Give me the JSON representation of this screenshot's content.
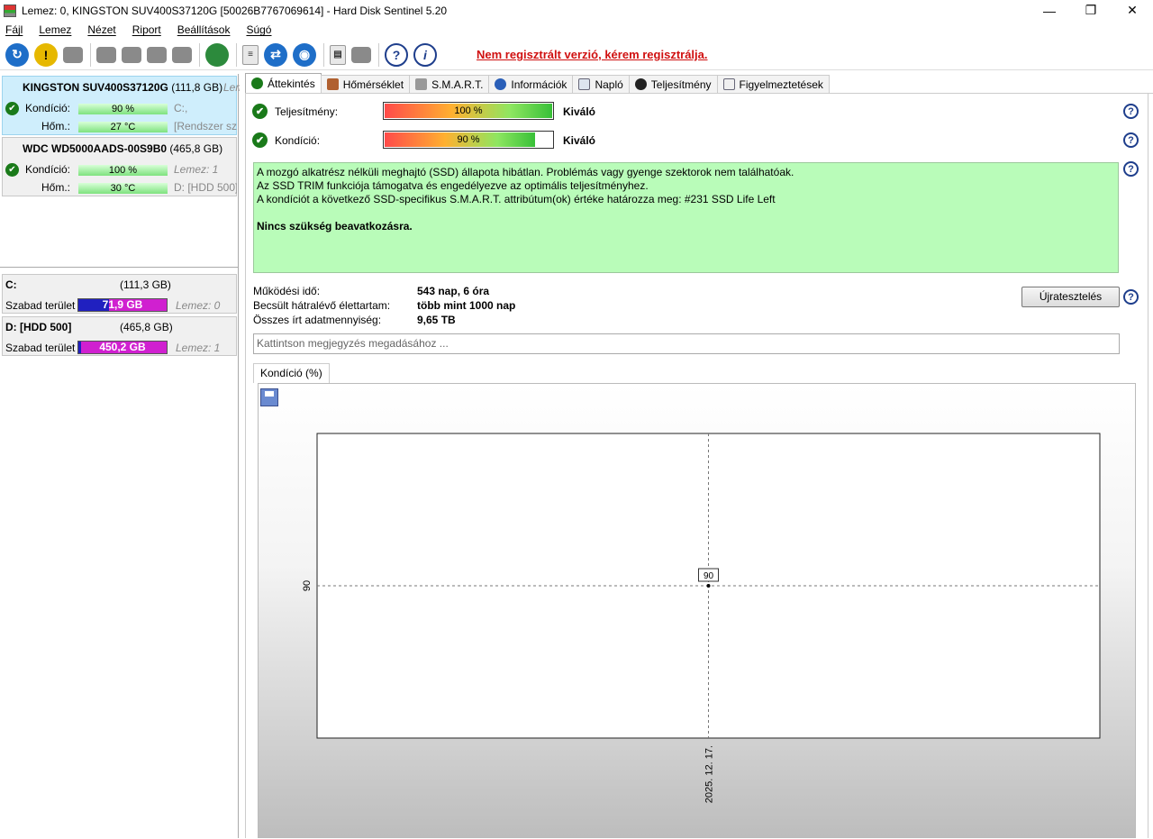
{
  "window": {
    "title": "Lemez: 0, KINGSTON SUV400S37120G [50026B7767069614]  -  Hard Disk Sentinel 5.20"
  },
  "menu": [
    "Fájl",
    "Lemez",
    "Nézet",
    "Riport",
    "Beállítások",
    "Súgó"
  ],
  "toolbar": {
    "register_note": "Nem regisztrált verzió, kérem regisztrálja."
  },
  "drives": [
    {
      "name": "KINGSTON SUV400S37120G",
      "size": "(111,8 GB)",
      "side_top": "Lem",
      "condition_label": "Kondíció:",
      "condition": "90 %",
      "condition_side": "C:,",
      "temp_label": "Hőm.:",
      "temp": "27 °C",
      "temp_side": "[Rendszer szá"
    },
    {
      "name": "WDC WD5000AADS-00S9B0",
      "size": "(465,8 GB)",
      "side_top": "",
      "condition_label": "Kondíció:",
      "condition": "100 %",
      "condition_side": "Lemez: 1",
      "temp_label": "Hőm.:",
      "temp": "30 °C",
      "temp_side": "D: [HDD 500]"
    }
  ],
  "volumes": [
    {
      "name": "C:",
      "size": "(111,3 GB)",
      "free_label": "Szabad terület",
      "free": "71,9 GB",
      "disk": "Lemez: 0",
      "used_fraction": 0.35
    },
    {
      "name": "D: [HDD 500]",
      "size": "(465,8 GB)",
      "free_label": "Szabad terület",
      "free": "450,2 GB",
      "disk": "Lemez: 1",
      "used_fraction": 0.03
    }
  ],
  "tabs": [
    "Áttekintés",
    "Hőmérséklet",
    "S.M.A.R.T.",
    "Információk",
    "Napló",
    "Teljesítmény",
    "Figyelmeztetések"
  ],
  "overview": {
    "performance_label": "Teljesítmény:",
    "performance": "100 %",
    "performance_value": 100,
    "performance_rating": "Kiváló",
    "condition_label": "Kondíció:",
    "condition": "90 %",
    "condition_value": 90,
    "condition_rating": "Kiváló",
    "status_lines": [
      "A mozgó alkatrész nélküli meghajtó (SSD) állapota hibátlan. Problémás vagy gyenge szektorok nem találhatóak.",
      "Az SSD TRIM funkciója támogatva és engedélyezve az optimális teljesítményhez.",
      "A kondíciót a következő SSD-specifikus S.M.A.R.T. attribútum(ok) értéke határozza meg:  #231 SSD Life Left"
    ],
    "status_bold": "Nincs szükség beavatkozásra.",
    "uptime_label": "Működési idő:",
    "uptime": "543 nap, 6 óra",
    "remaining_label": "Becsült hátralévő élettartam:",
    "remaining": "több mint 1000 nap",
    "written_label": "Összes írt adatmennyiség:",
    "written": "9,65 TB",
    "retest_button": "Újratesztelés",
    "note_placeholder": "Kattintson megjegyzés megadásához ..."
  },
  "chart_tab": "Kondíció  (%)",
  "chart_data": {
    "type": "line",
    "x": [
      "2025. 12. 17."
    ],
    "y": [
      90
    ],
    "point_labels": [
      "90"
    ],
    "ytick_labels": [
      "90"
    ],
    "xtick_labels": [
      "2025. 12. 17."
    ],
    "title": "",
    "xlabel": "",
    "ylabel": "",
    "grid": true
  }
}
